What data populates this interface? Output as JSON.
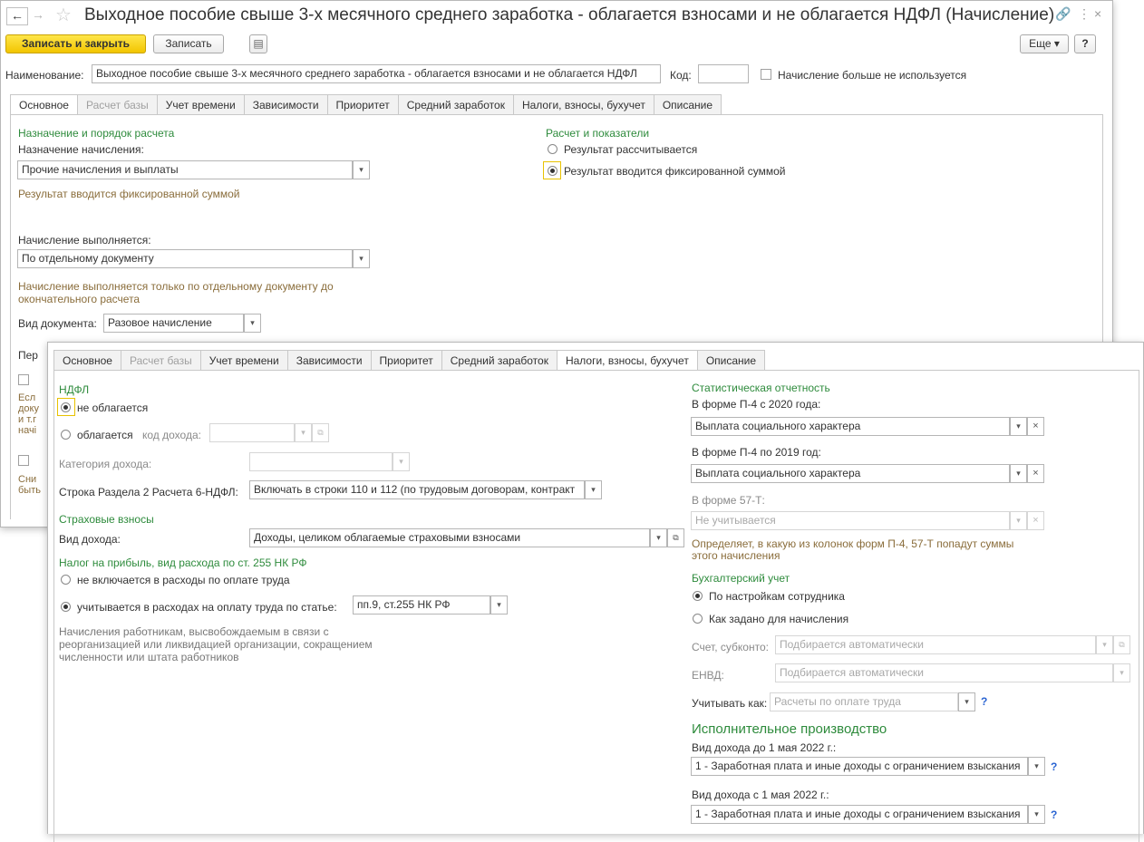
{
  "back": {
    "title": "Выходное пособие свыше 3-х месячного среднего заработка - облагается взносами и не облагается НДФЛ (Начисление)",
    "btn_save_close": "Записать и закрыть",
    "btn_save": "Записать",
    "btn_more": "Еще",
    "btn_help": "?",
    "name_label": "Наименование:",
    "name_value": "Выходное пособие свыше 3-х месячного среднего заработка - облагается взносами и не облагается НДФЛ",
    "code_label": "Код:",
    "unused_label": "Начисление больше не используется",
    "tabs": [
      "Основное",
      "Расчет базы",
      "Учет времени",
      "Зависимости",
      "Приоритет",
      "Средний заработок",
      "Налоги, взносы, бухучет",
      "Описание"
    ],
    "sec_purpose": "Назначение и порядок расчета",
    "purpose_label": "Назначение начисления:",
    "purpose_value": "Прочие начисления и выплаты",
    "purpose_note": "Результат вводится фиксированной суммой",
    "exec_label": "Начисление выполняется:",
    "exec_value": "По отдельному документу",
    "exec_note": "Начисление выполняется только по отдельному документу до окончательного расчета",
    "doc_label": "Вид документа:",
    "doc_value": "Разовое начисление",
    "per_label": "Пер",
    "sec_calc": "Расчет и показатели",
    "calc_opt1": "Результат рассчитывается",
    "calc_opt2": "Результат вводится фиксированной суммой",
    "frag1": "Есл",
    "frag2": "доку",
    "frag3": "и т.г",
    "frag4": "начі",
    "frag5": "Сни",
    "frag6": "быть"
  },
  "front": {
    "tabs": [
      "Основное",
      "Расчет базы",
      "Учет времени",
      "Зависимости",
      "Приоритет",
      "Средний заработок",
      "Налоги, взносы, бухучет",
      "Описание"
    ],
    "ndfl_title": "НДФЛ",
    "ndfl_opt1": "не облагается",
    "ndfl_opt2": "облагается",
    "income_code_label": "код дохода:",
    "income_cat_label": "Категория дохода:",
    "row6_label": "Строка Раздела 2 Расчета 6-НДФЛ:",
    "row6_value": "Включать в строки 110 и 112 (по трудовым договорам, контракт",
    "ins_title": "Страховые взносы",
    "ins_kind_label": "Вид дохода:",
    "ins_kind_value": "Доходы, целиком облагаемые страховыми взносами",
    "profit_title": "Налог на прибыль, вид расхода по ст. 255 НК РФ",
    "profit_opt1": "не включается в расходы по оплате труда",
    "profit_opt2": "учитывается в расходах на оплату труда по статье:",
    "profit_value": "пп.9, ст.255 НК РФ",
    "profit_note": "Начисления работникам, высвобождаемым в связи с реорганизацией или ликвидацией организации, сокращением численности или штата работников",
    "stat_title": "Статистическая отчетность",
    "p4_2020_label": "В форме П-4 с 2020 года:",
    "p4_2020_value": "Выплата социального характера",
    "p4_2019_label": "В форме П-4 по 2019 год:",
    "p4_2019_value": "Выплата социального характера",
    "f57_label": "В форме 57-Т:",
    "f57_value": "Не учитывается",
    "stat_note": "Определяет, в какую из колонок форм П-4, 57-Т попадут суммы этого начисления",
    "acc_title": "Бухгалтерский учет",
    "acc_opt1": "По настройкам сотрудника",
    "acc_opt2": "Как задано для начисления",
    "acct_label": "Счет, субконто:",
    "acct_value": "Подбирается автоматически",
    "envd_label": "ЕНВД:",
    "envd_value": "Подбирается автоматически",
    "consider_label": "Учитывать как:",
    "consider_value": "Расчеты по оплате труда",
    "exec_title": "Исполнительное производство",
    "before_label": "Вид дохода до 1 мая 2022 г.:",
    "before_value": "1 - Заработная плата и иные доходы с ограничением взыскания",
    "after_label": "Вид дохода с 1 мая 2022 г.:",
    "after_value": "1 - Заработная плата и иные доходы с ограничением взыскания",
    "help": "?"
  }
}
